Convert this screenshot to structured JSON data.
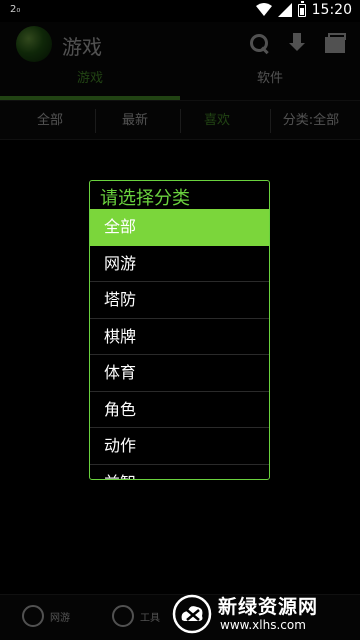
{
  "statusbar": {
    "left_indicator": "2₀",
    "time": "15:20"
  },
  "app": {
    "title": "游戏"
  },
  "tabs": [
    {
      "label": "游戏",
      "active": true
    },
    {
      "label": "软件",
      "active": false
    }
  ],
  "filters": [
    {
      "label": "全部"
    },
    {
      "label": "最新"
    },
    {
      "label": "喜欢",
      "active": true
    },
    {
      "label": "分类:全部"
    }
  ],
  "bottom_bar": [
    {
      "label": "网游"
    },
    {
      "label": "工具"
    }
  ],
  "watermark": {
    "title": "新绿资源网",
    "url": "www.xlhs.com"
  },
  "dialog": {
    "title": "请选择分类",
    "items": [
      "全部",
      "网游",
      "塔防",
      "棋牌",
      "体育",
      "角色",
      "动作",
      "益智"
    ],
    "selected": "全部"
  },
  "colors": {
    "accent": "#6ad23e",
    "selected_bg": "#7bd63b",
    "background": "#000000"
  }
}
